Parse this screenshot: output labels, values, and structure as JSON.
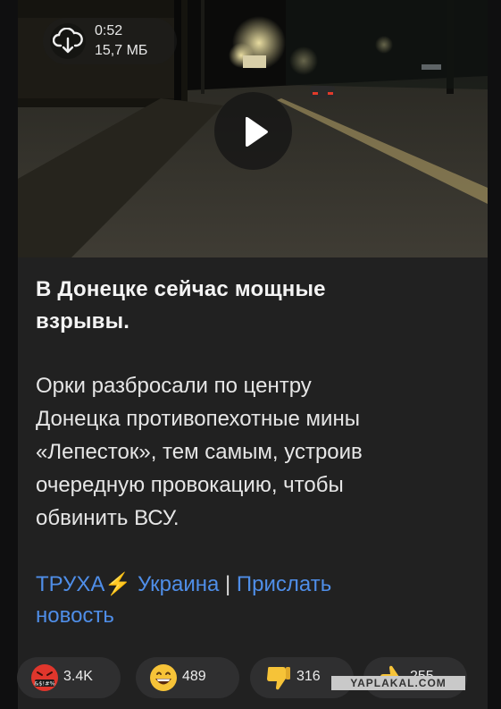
{
  "video": {
    "duration": "0:52",
    "file_size": "15,7 МБ"
  },
  "post": {
    "headline_line1": "В Донецке сейчас мощные",
    "headline_line2": "взрывы.",
    "body_line1": "Орки разбросали по центру",
    "body_line2": "Донецка противопехотные мины",
    "body_line3": "«Лепесток», тем самым, устроив",
    "body_line4": "очередную провокацию, чтобы",
    "body_line5": "обвинить ВСУ."
  },
  "links": {
    "channel_part1": "ТРУХА",
    "bolt": "⚡",
    "channel_part2": "Украина",
    "separator": "|",
    "submit_line1": "Прислать",
    "submit_line2": "новость"
  },
  "reactions": [
    {
      "icon": "angry-face-icon",
      "count": "3.4K"
    },
    {
      "icon": "grinning-face-icon",
      "count": "489"
    },
    {
      "icon": "thumbs-down-icon",
      "count": "316"
    },
    {
      "icon": "thumbs-up-icon",
      "count": "255"
    }
  ],
  "angry_symbols": "&$!#%",
  "watermark": "YAPLAKAL.COM",
  "colors": {
    "link": "#4f8ee8",
    "bubble_bg": "#212121",
    "reaction_bg": "#2f2f30",
    "emoji_yellow": "#f6c338",
    "angry_red": "#e0362c"
  }
}
